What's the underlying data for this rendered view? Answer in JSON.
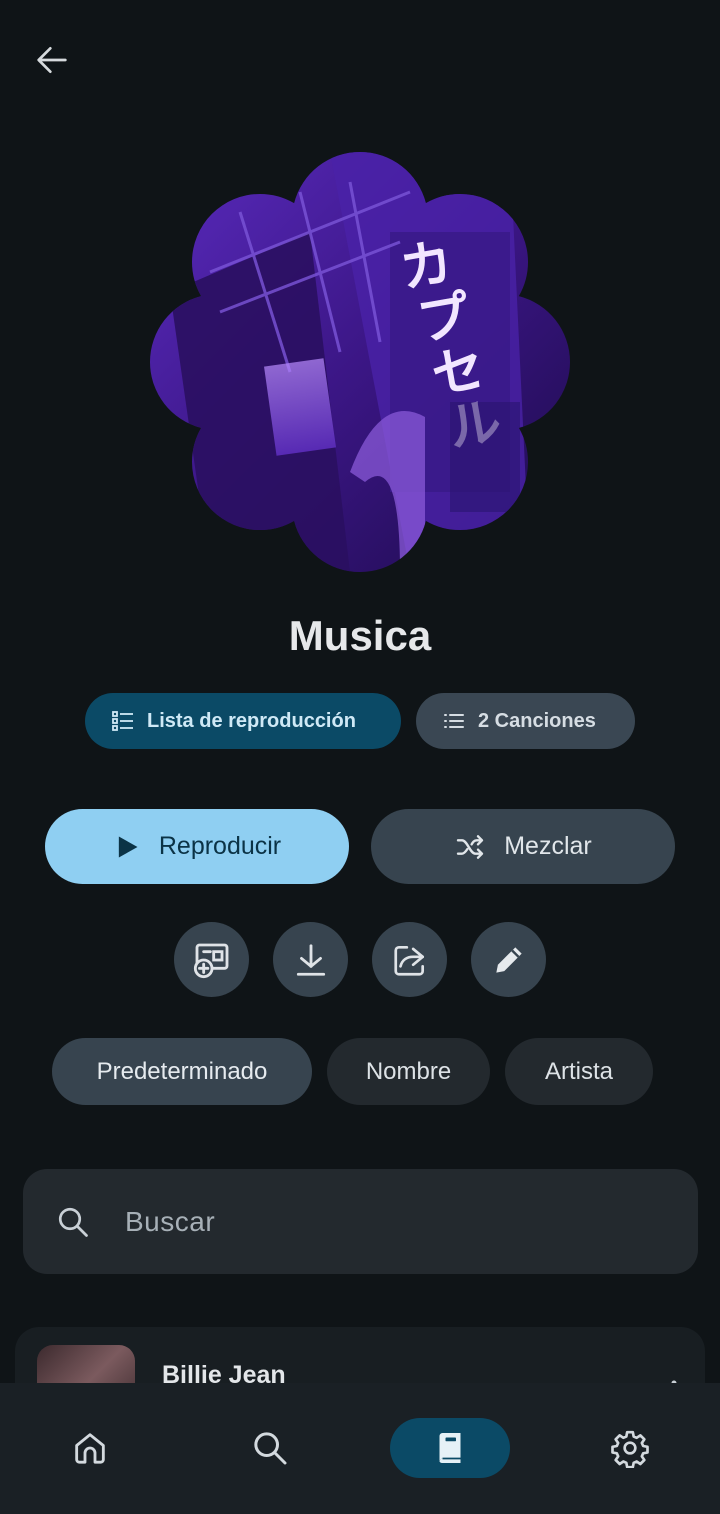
{
  "playlist": {
    "title": "Musica",
    "type_label": "Lista de reproducción",
    "count_label": "2 Canciones"
  },
  "actions": {
    "play_label": "Reproducir",
    "shuffle_label": "Mezclar"
  },
  "icon_actions": [
    "add-to-playlist-icon",
    "download-icon",
    "share-icon",
    "edit-icon"
  ],
  "sort": {
    "options": [
      "Predeterminado",
      "Nombre",
      "Artista"
    ],
    "selected": "Predeterminado"
  },
  "search": {
    "placeholder": "Buscar"
  },
  "songs": [
    {
      "title": "Billie Jean"
    }
  ],
  "nav": {
    "items": [
      "home-icon",
      "search-icon",
      "library-icon",
      "settings-icon"
    ],
    "active": "library-icon"
  },
  "colors": {
    "background": "#0f1417",
    "accent": "#8fcff2",
    "active_chip": "#0b4a66",
    "surface": "#37444f"
  }
}
